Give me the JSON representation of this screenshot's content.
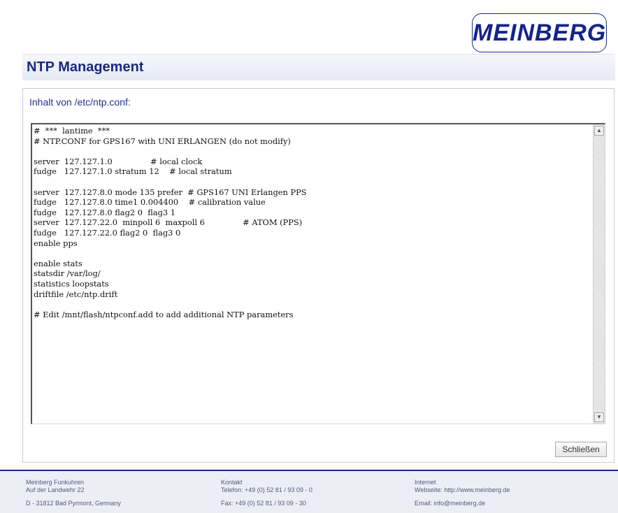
{
  "logo": {
    "text": "MEINBERG"
  },
  "page_title": "NTP Management",
  "panel": {
    "heading": "Inhalt von /etc/ntp.conf:",
    "config_lines": [
      "#  ***  lantime  ***",
      "# NTP.CONF for GPS167 with UNI ERLANGEN (do not modify)",
      "",
      "server  127.127.1.0               # local clock",
      "fudge   127.127.1.0 stratum 12    # local stratum",
      "",
      "server  127.127.8.0 mode 135 prefer  # GPS167 UNI Erlangen PPS",
      "fudge   127.127.8.0 time1 0.004400    # calibration value",
      "fudge   127.127.8.0 flag2 0  flag3 1",
      "server  127.127.22.0  minpoll 6  maxpoll 6               # ATOM (PPS)",
      "fudge   127.127.22.0 flag2 0  flag3 0",
      "enable pps",
      "",
      "enable stats",
      "statsdir /var/log/",
      "statistics loopstats",
      "driftfile /etc/ntp.drift",
      "",
      "# Edit /mnt/flash/ntpconf.add to add additional NTP parameters"
    ],
    "close_button_label": "Schließen"
  },
  "footer": {
    "company": {
      "name": "Meinberg Funkuhren",
      "street": "Auf der Landwehr 22",
      "city": "D - 31812 Bad Pyrmont, Germany"
    },
    "contact": {
      "heading": "Kontakt",
      "phone": "Telefon: +49 (0) 52 81 / 93 09 - 0",
      "fax": "Fax: +49 (0) 52 81 / 93 09 - 30"
    },
    "internet": {
      "heading": "Internet",
      "website": "Webseite: http://www.meinberg.de",
      "email": "Email: info@meinberg.de"
    }
  }
}
